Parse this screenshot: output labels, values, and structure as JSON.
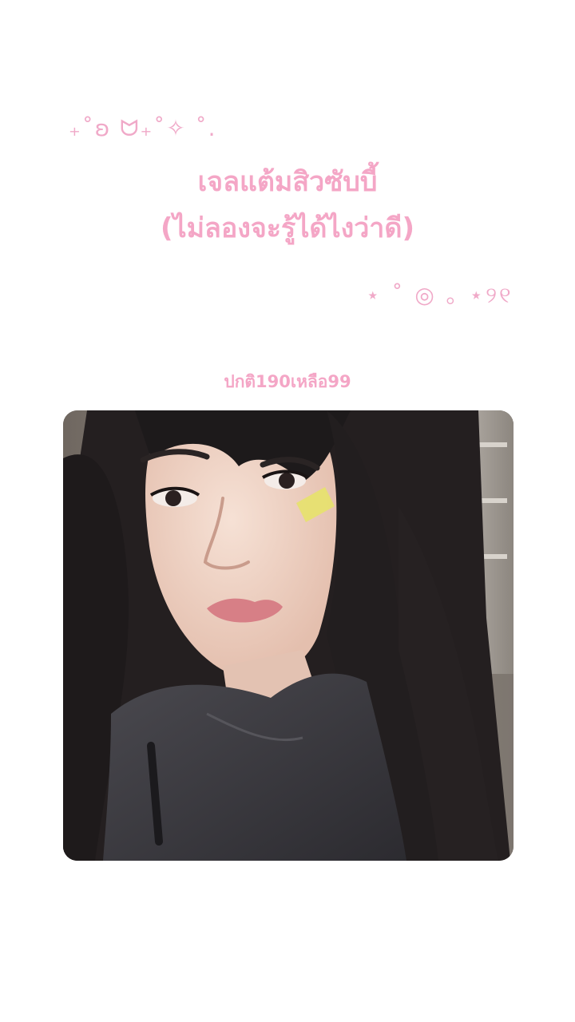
{
  "decorations": {
    "top": "₊˚ʚ ᗢ₊˚✧ ˚.",
    "middle": "⋆ ˚ ◎ ｡ ⋆୨୧"
  },
  "title": {
    "line1": "เจลแต้มสิวซับบี้",
    "line2": "(ไม่ลองจะรู้ได้ไงว่าดี)"
  },
  "price_text": "ปกติ190เหลือ99",
  "photo": {
    "subject": "selfie of woman with long dark hair wearing acne patch and dark jacket",
    "colors": {
      "background": "#8a8178",
      "hair": "#1f1c1d",
      "skin": "#f0d5c6",
      "lips": "#d77f86",
      "jacket": "#3e3d42",
      "patch": "#e7e26c"
    }
  },
  "colors": {
    "accent": "#f4a6c6",
    "background": "#ffffff"
  }
}
